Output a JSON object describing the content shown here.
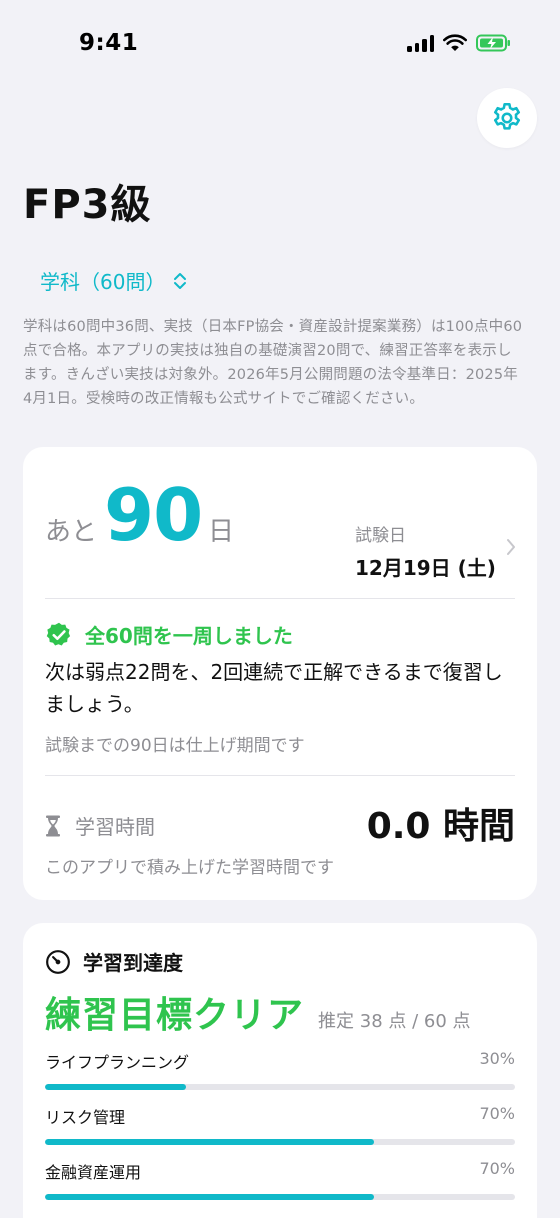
{
  "status_bar": {
    "time": "9:41"
  },
  "header": {
    "title": "FP3級",
    "exam_selector": "学科（60問）",
    "description": "学科は60問中36問、実技（日本FP協会・資産設計提案業務）は100点中60点で合格。本アプリの実技は独自の基礎演習20問で、練習正答率を表示します。きんざい実技は対象外。2026年5月公開問題の法令基準日：2025年4月1日。受検時の改正情報も公式サイトでご確認ください。"
  },
  "countdown": {
    "prefix": "あと",
    "days": "90",
    "suffix": "日",
    "exam_date_label": "試験日",
    "exam_date": "12月19日 (土)",
    "complete_message": "全60問を一周しました",
    "next_message": "次は弱点22問を、2回連続で正解できるまで復習しましょう。",
    "period_message": "試験までの90日は仕上げ期間です",
    "study_time_label": "学習時間",
    "study_time_value": "0.0 時間",
    "study_time_note": "このアプリで積み上げた学習時間です"
  },
  "progress": {
    "title": "学習到達度",
    "goal": "練習目標クリア",
    "estimate": "推定 38 点 / 60 点",
    "categories": [
      {
        "name": "ライフプランニング",
        "percent_label": "30%",
        "value": 30
      },
      {
        "name": "リスク管理",
        "percent_label": "70%",
        "value": 70
      },
      {
        "name": "金融資産運用",
        "percent_label": "70%",
        "value": 70
      }
    ]
  },
  "colors": {
    "accent": "#10b9c9",
    "success": "#2fc44e",
    "secondary_text": "#8e8e93",
    "background": "#f2f2f7"
  },
  "icons": [
    "gear-icon",
    "chevron-up-down-icon",
    "chevron-right-icon",
    "check-badge-icon",
    "hourglass-icon",
    "gauge-icon",
    "signal-icon",
    "wifi-icon",
    "battery-charging-icon"
  ]
}
